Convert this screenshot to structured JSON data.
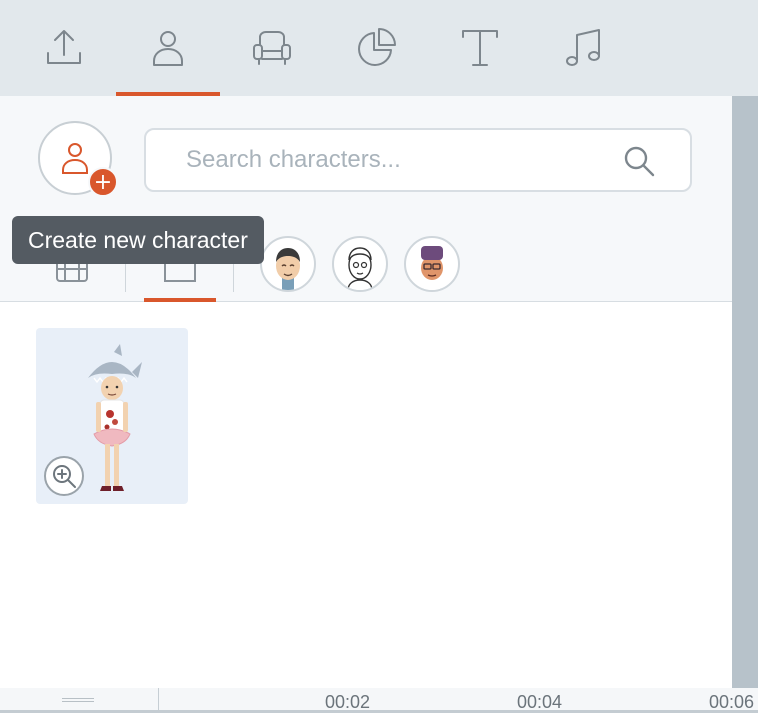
{
  "top_tabs": [
    {
      "icon": "upload-icon",
      "active": false
    },
    {
      "icon": "character-icon",
      "active": true
    },
    {
      "icon": "props-icon",
      "active": false
    },
    {
      "icon": "chart-icon",
      "active": false
    },
    {
      "icon": "text-icon",
      "active": false
    },
    {
      "icon": "music-icon",
      "active": false
    }
  ],
  "search": {
    "placeholder": "Search characters..."
  },
  "create_character": {
    "tooltip": "Create new character"
  },
  "filter_tabs": [
    {
      "icon": "film-icon",
      "active": false
    },
    {
      "icon": "folder-icon",
      "active": true
    }
  ],
  "style_avatars": [
    "avatar-style-1",
    "avatar-style-2",
    "avatar-style-3"
  ],
  "characters": [
    {
      "name": "shark-hat-character",
      "icon": "zoom-in-icon"
    }
  ],
  "timeline": {
    "ticks": [
      "00:02",
      "00:04",
      "00:06"
    ]
  },
  "colors": {
    "accent": "#d9572c",
    "tooltip_bg": "#545b62",
    "card_bg": "#e8eff8"
  }
}
